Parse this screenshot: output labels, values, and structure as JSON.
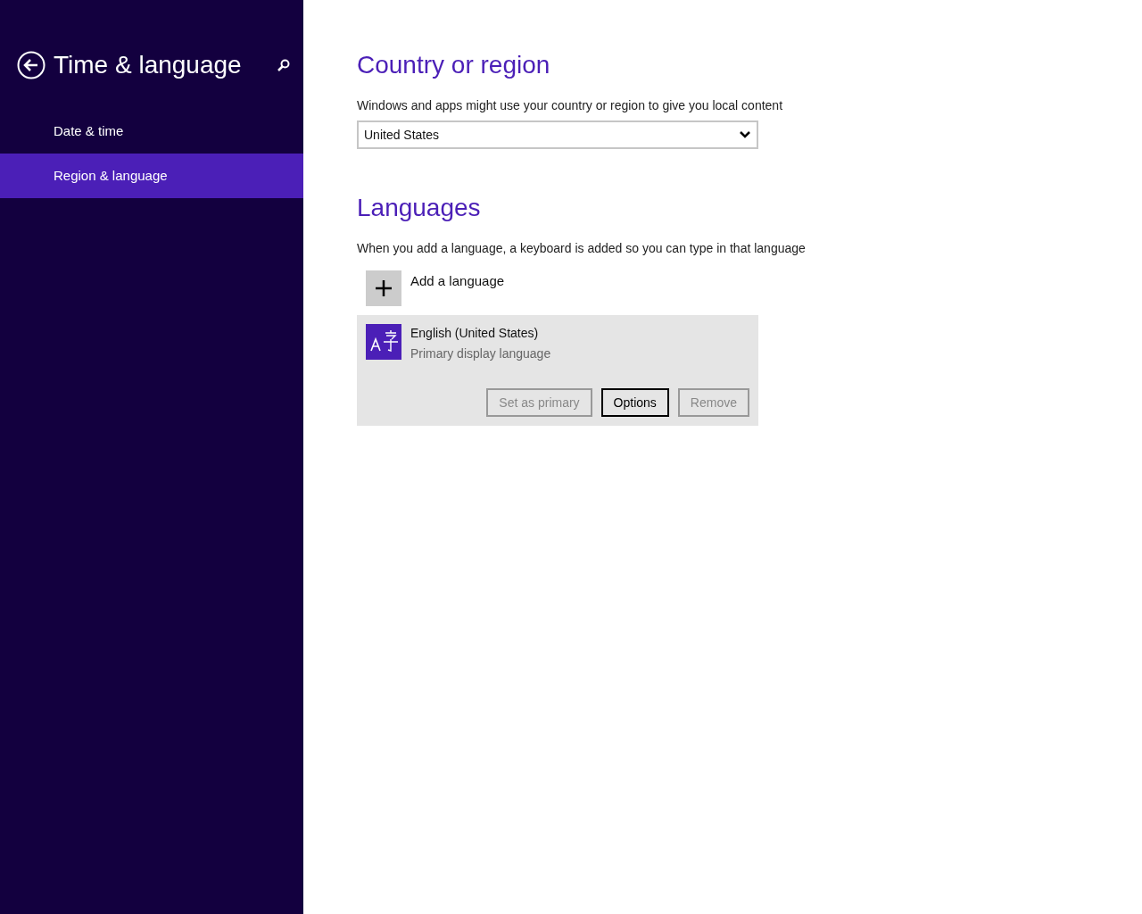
{
  "sidebar": {
    "title": "Time & language",
    "items": [
      {
        "label": "Date & time",
        "selected": false
      },
      {
        "label": "Region & language",
        "selected": true
      }
    ]
  },
  "country": {
    "heading": "Country or region",
    "description": "Windows and apps might use your country or region to give you local content",
    "dropdown_value": "United States"
  },
  "languages": {
    "heading": "Languages",
    "description": "When you add a language, a keyboard is added so you can type in that language",
    "add_label": "Add a language",
    "items": [
      {
        "name": "English (United States)",
        "subtitle": "Primary display language",
        "selected": true,
        "buttons": [
          {
            "label": "Set as primary",
            "disabled": true
          },
          {
            "label": "Options",
            "disabled": false
          },
          {
            "label": "Remove",
            "disabled": true
          }
        ]
      }
    ]
  }
}
